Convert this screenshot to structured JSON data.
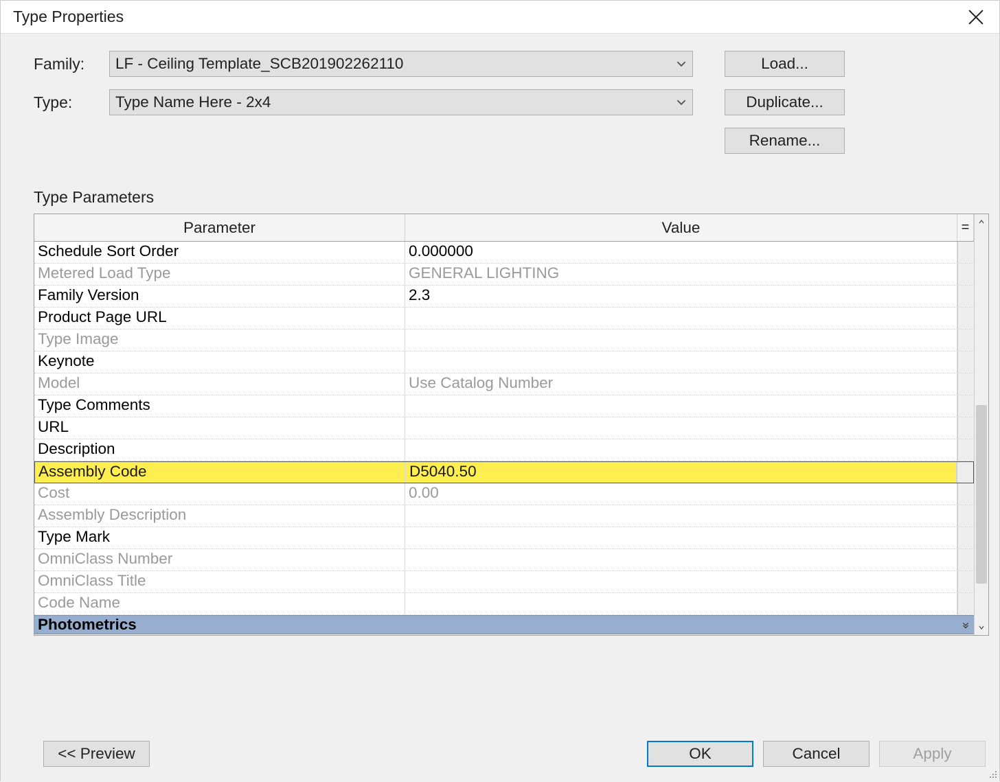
{
  "title": "Type Properties",
  "labels": {
    "family": "Family:",
    "type": "Type:",
    "type_parameters": "Type Parameters"
  },
  "family_value": "LF - Ceiling Template_SCB201902262110",
  "type_value": "Type Name Here - 2x4",
  "buttons": {
    "load": "Load...",
    "duplicate": "Duplicate...",
    "rename": "Rename...",
    "preview": "<< Preview",
    "ok": "OK",
    "cancel": "Cancel",
    "apply": "Apply"
  },
  "headers": {
    "parameter": "Parameter",
    "value": "Value",
    "eq": "="
  },
  "rows": [
    {
      "param": "Schedule Sort Order",
      "value": "0.000000",
      "gray": false,
      "hl": false
    },
    {
      "param": "Metered Load Type",
      "value": "GENERAL LIGHTING",
      "gray": true,
      "hl": false
    },
    {
      "param": "Family Version",
      "value": "2.3",
      "gray": false,
      "hl": false
    },
    {
      "param": "Product Page URL",
      "value": "",
      "gray": false,
      "hl": false
    },
    {
      "param": "Type Image",
      "value": "",
      "gray": true,
      "hl": false
    },
    {
      "param": "Keynote",
      "value": "",
      "gray": false,
      "hl": false
    },
    {
      "param": "Model",
      "value": "Use Catalog Number",
      "gray": true,
      "hl": false
    },
    {
      "param": "Type Comments",
      "value": "",
      "gray": false,
      "hl": false
    },
    {
      "param": "URL",
      "value": "",
      "gray": false,
      "hl": false
    },
    {
      "param": "Description",
      "value": "",
      "gray": false,
      "hl": false
    },
    {
      "param": "Assembly Code",
      "value": "D5040.50",
      "gray": false,
      "hl": true
    },
    {
      "param": "Cost",
      "value": "0.00",
      "gray": true,
      "hl": false
    },
    {
      "param": "Assembly Description",
      "value": "",
      "gray": true,
      "hl": false
    },
    {
      "param": "Type Mark",
      "value": "",
      "gray": false,
      "hl": false
    },
    {
      "param": "OmniClass Number",
      "value": "",
      "gray": true,
      "hl": false
    },
    {
      "param": "OmniClass Title",
      "value": "",
      "gray": true,
      "hl": false
    },
    {
      "param": "Code Name",
      "value": "",
      "gray": true,
      "hl": false
    }
  ],
  "group_row": "Photometrics"
}
